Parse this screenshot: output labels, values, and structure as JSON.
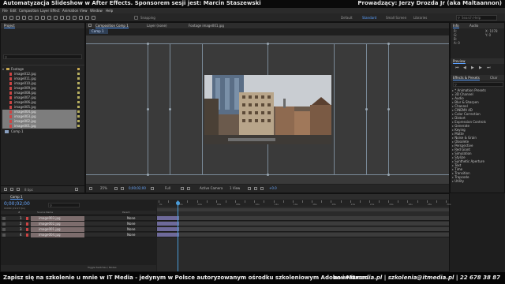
{
  "banner": {
    "left": "Automatyzacja Slideshow w After Effects. Sponsorem sesji jest: Marcin Staszewski",
    "right": "Prowadzący: Jerzy Drozda Jr (aka Maltaannon)"
  },
  "menu": [
    "File",
    "Edit",
    "Composition",
    "Layer",
    "Effect",
    "Animation",
    "View",
    "Window",
    "Help"
  ],
  "toolbar": {
    "snapping": "Snapping",
    "workspaces": [
      "Default",
      "Standard",
      "Small Screen",
      "Libraries"
    ],
    "active_workspace": "Standard",
    "search_placeholder": "Search Help"
  },
  "project": {
    "tab": "Project",
    "items": [
      {
        "name": "Footage",
        "type": "folder"
      },
      {
        "name": "image012.jpg",
        "type": "jpg"
      },
      {
        "name": "image011.jpg",
        "type": "jpg"
      },
      {
        "name": "image010.jpg",
        "type": "jpg"
      },
      {
        "name": "image009.jpg",
        "type": "jpg"
      },
      {
        "name": "image008.jpg",
        "type": "jpg"
      },
      {
        "name": "image007.jpg",
        "type": "jpg"
      },
      {
        "name": "image006.jpg",
        "type": "jpg"
      },
      {
        "name": "image005.jpg",
        "type": "jpg"
      },
      {
        "name": "image004.jpg",
        "type": "jpg",
        "selected": true
      },
      {
        "name": "image003.jpg",
        "type": "jpg",
        "selected": true
      },
      {
        "name": "image002.jpg",
        "type": "jpg",
        "selected": true
      },
      {
        "name": "image001.jpg",
        "type": "jpg",
        "selected": true
      },
      {
        "name": "Comp 1",
        "type": "comp"
      }
    ],
    "bpc": "8 bpc"
  },
  "viewer": {
    "tabs": [
      "Composition Comp 1",
      "Layer (none)",
      "Footage image001.jpg"
    ],
    "subtab": "Comp 1",
    "zoom": "25%",
    "timecode": "0;00;02;00",
    "resolution": "Full",
    "camera": "Active Camera",
    "views": "1 View",
    "offset": "+0.0"
  },
  "info": {
    "tabs": [
      "Info",
      "Audio"
    ],
    "coords": [
      "X: 0",
      "Y: 0"
    ],
    "values": [
      "R:",
      "G:",
      "B:",
      "A: 0"
    ],
    "extra": [
      "X: 1078",
      "Y: 0"
    ]
  },
  "preview": {
    "title": "Preview"
  },
  "effects": {
    "tabs": [
      "Effects & Presets",
      "Char"
    ],
    "items": [
      "* Animation Presets",
      "3D Channel",
      "Audio",
      "Blur & Sharpen",
      "Channel",
      "CINEMA 4D",
      "Color Correction",
      "Distort",
      "Expression Controls",
      "Generate",
      "Keying",
      "Matte",
      "Noise & Grain",
      "Obsolete",
      "Perspective",
      "Red Giant",
      "Simulation",
      "Stylize",
      "Synthetic Aperture",
      "Text",
      "Time",
      "Transition",
      "Trapcode",
      "Utility"
    ]
  },
  "paragraph": {
    "tabs": [
      "Paragraph",
      "Align"
    ],
    "fields": [
      "0 px",
      "0 px",
      "0 px",
      "0 px",
      "0 px"
    ]
  },
  "timeline": {
    "tab": "Comp 1",
    "timecode": "0;00;02;00",
    "fps": "00060 (29.97 fps)",
    "columns": [
      "#",
      "Source Name",
      "Parent"
    ],
    "layers": [
      {
        "num": "1",
        "name": "image003.jpg",
        "parent": "None"
      },
      {
        "num": "2",
        "name": "image002.jpg",
        "parent": "None"
      },
      {
        "num": "3",
        "name": "image001.jpg",
        "parent": "None"
      },
      {
        "num": "4",
        "name": "image004.jpg",
        "parent": "None"
      }
    ],
    "ruler": [
      "0s",
      "01s",
      "02s",
      "03s",
      "04s",
      "05s",
      "06s",
      "07s",
      "08s",
      "09s",
      "10s",
      "11s",
      "12s",
      "13s",
      "14s",
      "15s",
      "16s",
      "17s",
      "18s",
      "19s",
      "20s",
      "21s",
      "22s",
      "23s",
      "24s",
      "25s",
      "26s",
      "27s",
      "28s",
      "29s",
      "30s"
    ],
    "toggle": "Toggle Switches / Modes",
    "playhead": 0.066
  },
  "footer": {
    "left": "Zapisz się na szkolenie u mnie w IT Media - jedynym w Polsce autoryzowanym ośrodku szkoleniowym Adobe i Maxon.",
    "right": "www.itmedia.pl | szkolenia@itmedia.pl | 22 678 38 87"
  },
  "colors": {
    "accent": "#5aa0ff",
    "layer_bar": "#6e6a9a",
    "playhead": "#4a9bd8",
    "jpg_icon": "#cc4444"
  }
}
